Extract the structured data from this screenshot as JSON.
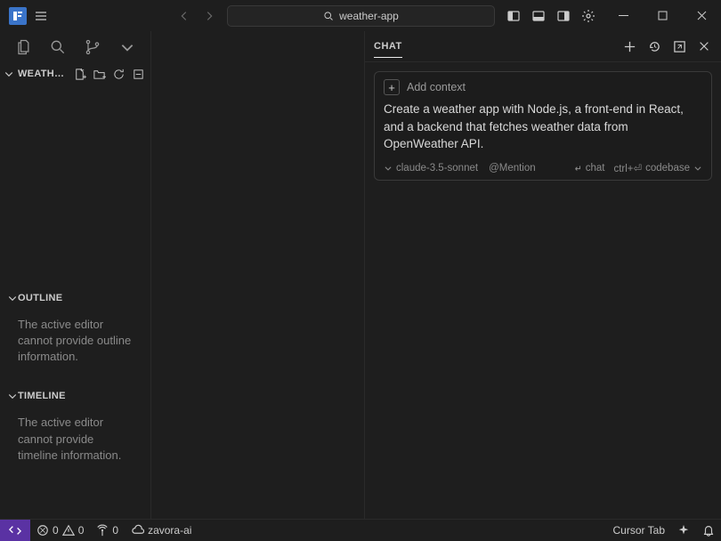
{
  "titlebar": {
    "search_text": "weather-app"
  },
  "sidebar": {
    "explorer_header": "WEATH…",
    "outline": {
      "title": "OUTLINE",
      "msg": "The active editor cannot provide outline information."
    },
    "timeline": {
      "title": "TIMELINE",
      "msg": "The active editor cannot provide timeline information."
    }
  },
  "chat": {
    "tab_label": "CHAT",
    "add_context": "Add context",
    "prompt": "Create a weather app with Node.js, a front-end in React, and a backend that fetches weather data from OpenWeather API.",
    "model": "claude-3.5-sonnet",
    "mention_label": "@Mention",
    "submit_label": "chat",
    "shortcut": "ctrl+⏎",
    "scope": "codebase"
  },
  "status": {
    "errors": "0",
    "warnings": "0",
    "ports": "0",
    "cloud": "zavora-ai",
    "cursor_tab": "Cursor Tab"
  }
}
